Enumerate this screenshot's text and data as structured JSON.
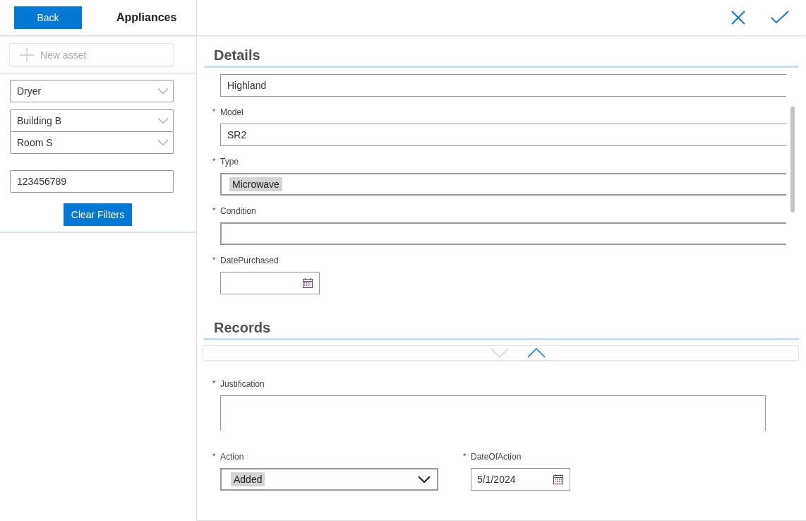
{
  "header": {
    "back_button": "Back",
    "title": "Appliances"
  },
  "new_asset": {
    "label": "New asset",
    "disabled": true
  },
  "filters": [
    {
      "kind": "dropdown",
      "value": "Dryer"
    },
    {
      "kind": "dropdown",
      "value": "Building B"
    },
    {
      "kind": "dropdown",
      "value": "Room S"
    },
    {
      "kind": "text",
      "value": "123456789"
    }
  ],
  "clear_button": "Clear Filters",
  "details": {
    "title": "Details",
    "fields": [
      {
        "kind": "text",
        "value": "Highland"
      },
      {
        "kind": "text",
        "required_mark": "*",
        "label": "Model",
        "value": "SR2"
      },
      {
        "kind": "tag",
        "required_mark": "*",
        "label": "Type",
        "value": "Microwave"
      },
      {
        "kind": "combo",
        "required_mark": "*",
        "label": "Condition"
      },
      {
        "kind": "date",
        "required_mark": "*",
        "label": "DatePurchased"
      }
    ]
  },
  "records": {
    "title": "Records",
    "toggle": {
      "down_enabled": false,
      "up_enabled": true
    },
    "fields": [
      {
        "kind": "textarea",
        "required_mark": "*",
        "label": "Justification"
      }
    ],
    "row": [
      {
        "kind": "dropdown",
        "required_mark": "*",
        "label": "Action",
        "value": "Added"
      },
      {
        "kind": "date",
        "required_mark": "*",
        "label": "DateOfAction",
        "value": "5/1/2024"
      }
    ]
  }
}
